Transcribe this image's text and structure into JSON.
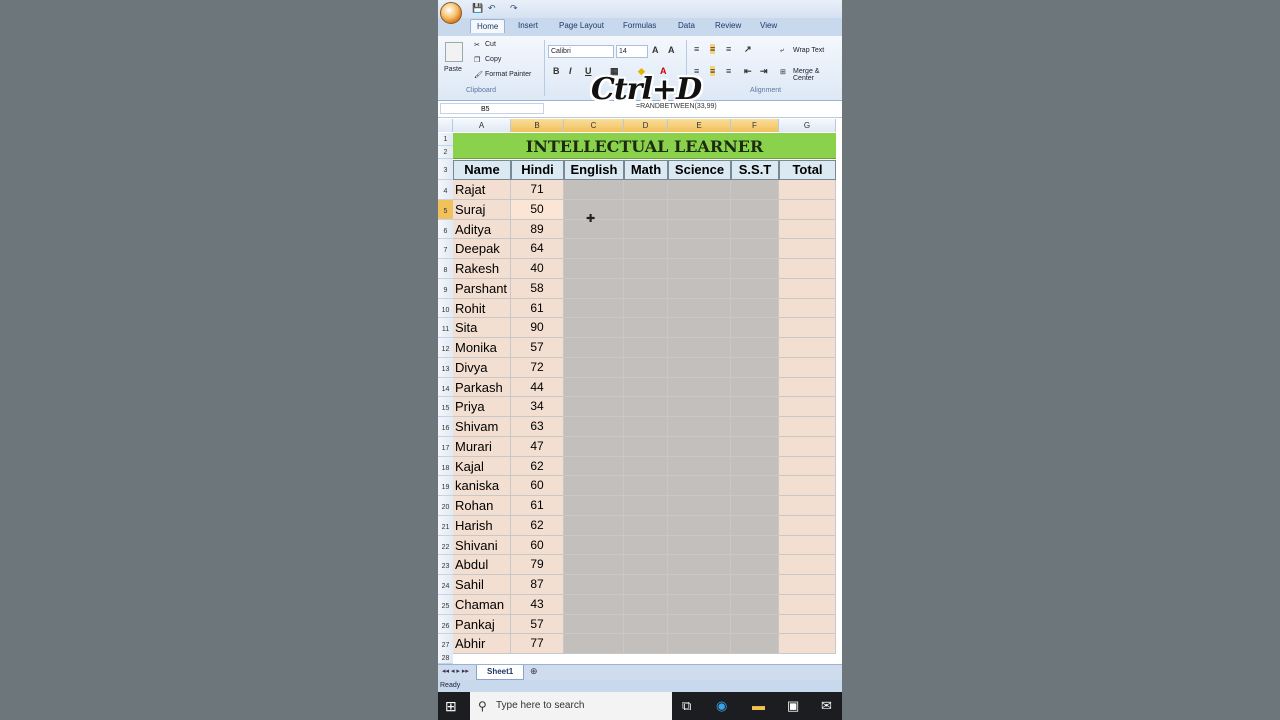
{
  "qat": {
    "save": "💾",
    "undo": "↶",
    "redo": "↷"
  },
  "ribbon": {
    "tabs": [
      "Home",
      "Insert",
      "Page Layout",
      "Formulas",
      "Data",
      "Review",
      "View"
    ],
    "clipboard": {
      "paste": "Paste",
      "cut": "Cut",
      "copy": "Copy",
      "format_painter": "Format Painter",
      "label": "Clipboard"
    },
    "font": {
      "name": "Calibri",
      "size": "14"
    },
    "alignment": {
      "wrap_text": "Wrap Text",
      "merge": "Merge & Center",
      "label": "Alignment"
    }
  },
  "formula_bar": {
    "name_box": "B5",
    "formula": "=RANDBETWEEN(33,99)"
  },
  "overlay_text": "Ctrl+D",
  "columns": [
    "A",
    "B",
    "C",
    "D",
    "E",
    "F",
    "G"
  ],
  "sheet": {
    "title": "INTELLECTUAL LEARNER",
    "headers": [
      "Name",
      "Hindi",
      "English",
      "Math",
      "Science",
      "S.S.T",
      "Total"
    ],
    "rows": [
      {
        "name": "Rajat",
        "hindi": "71"
      },
      {
        "name": "Suraj",
        "hindi": "50"
      },
      {
        "name": "Aditya",
        "hindi": "89"
      },
      {
        "name": "Deepak",
        "hindi": "64"
      },
      {
        "name": "Rakesh",
        "hindi": "40"
      },
      {
        "name": "Parshant",
        "hindi": "58"
      },
      {
        "name": "Rohit",
        "hindi": "61"
      },
      {
        "name": "Sita",
        "hindi": "90"
      },
      {
        "name": "Monika",
        "hindi": "57"
      },
      {
        "name": "Divya",
        "hindi": "72"
      },
      {
        "name": "Parkash",
        "hindi": "44"
      },
      {
        "name": "Priya",
        "hindi": "34"
      },
      {
        "name": "Shivam",
        "hindi": "63"
      },
      {
        "name": "Murari",
        "hindi": "47"
      },
      {
        "name": "Kajal",
        "hindi": "62"
      },
      {
        "name": "kaniska",
        "hindi": "60"
      },
      {
        "name": "Rohan",
        "hindi": "61"
      },
      {
        "name": "Harish",
        "hindi": "62"
      },
      {
        "name": "Shivani",
        "hindi": "60"
      },
      {
        "name": "Abdul",
        "hindi": "79"
      },
      {
        "name": "Sahil",
        "hindi": "87"
      },
      {
        "name": "Chaman",
        "hindi": "43"
      },
      {
        "name": "Pankaj",
        "hindi": "57"
      },
      {
        "name": "Abhir",
        "hindi": "77"
      }
    ]
  },
  "sheet_tab": "Sheet1",
  "status": "Ready",
  "taskbar": {
    "search_placeholder": "Type here to search"
  },
  "colors": {
    "title_bg": "#8bd24c",
    "name_bg": "#f2dfd1",
    "selection_gray": "#c2bfbd",
    "header_bg": "#dbe9f3"
  }
}
